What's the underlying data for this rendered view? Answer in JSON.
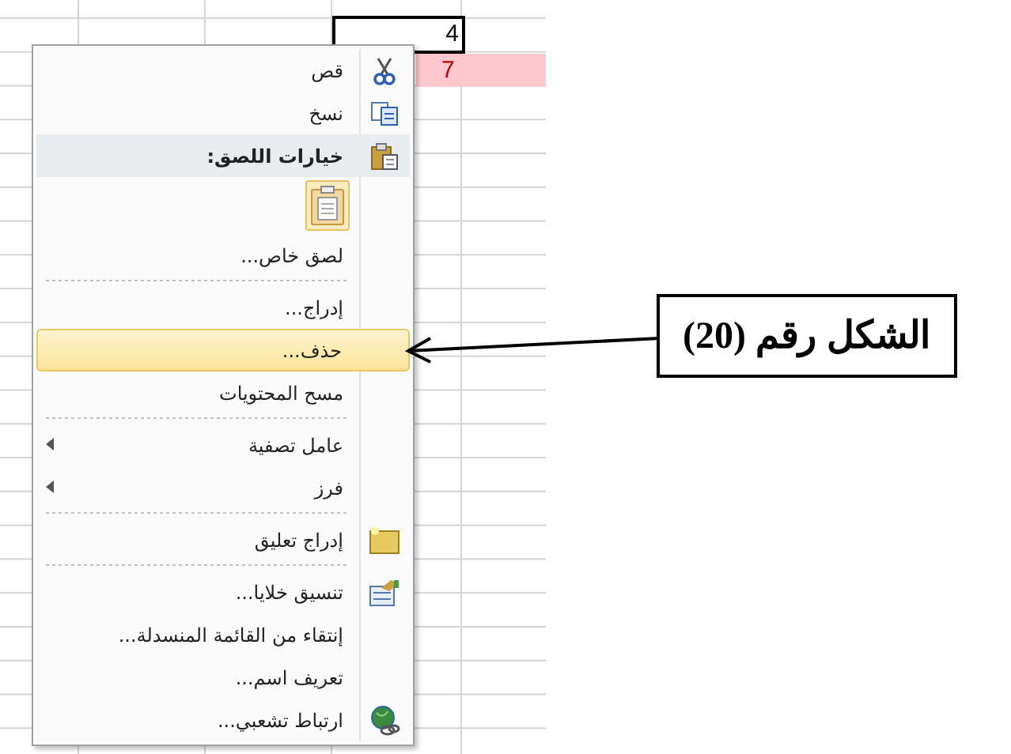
{
  "sheet": {
    "active_cell": "4",
    "highlighted_cell": "7"
  },
  "context_menu": {
    "items": [
      {
        "kind": "item",
        "label": "قص",
        "highlighted": false,
        "submenu": false
      },
      {
        "kind": "item",
        "label": "نسخ",
        "highlighted": false,
        "submenu": false
      },
      {
        "kind": "header",
        "label": "خيارات اللصق:"
      },
      {
        "kind": "paste_option"
      },
      {
        "kind": "item",
        "label": "لصق خاص...",
        "highlighted": false,
        "submenu": false
      },
      {
        "kind": "separator"
      },
      {
        "kind": "item",
        "label": "إدراج...",
        "highlighted": false,
        "submenu": false
      },
      {
        "kind": "item",
        "label": "حذف...",
        "highlighted": true,
        "submenu": false
      },
      {
        "kind": "item",
        "label": "مسح المحتويات",
        "highlighted": false,
        "submenu": false
      },
      {
        "kind": "separator"
      },
      {
        "kind": "item",
        "label": "عامل تصفية",
        "highlighted": false,
        "submenu": true
      },
      {
        "kind": "item",
        "label": "فرز",
        "highlighted": false,
        "submenu": true
      },
      {
        "kind": "separator"
      },
      {
        "kind": "item",
        "label": "إدراج تعليق",
        "highlighted": false,
        "submenu": false
      },
      {
        "kind": "separator"
      },
      {
        "kind": "item",
        "label": "تنسيق خلايا...",
        "highlighted": false,
        "submenu": false
      },
      {
        "kind": "item",
        "label": "إنتقاء من القائمة المنسدلة...",
        "highlighted": false,
        "submenu": false
      },
      {
        "kind": "item",
        "label": "تعريف اسم...",
        "highlighted": false,
        "submenu": false
      },
      {
        "kind": "item",
        "label": "ارتباط تشعبي...",
        "highlighted": false,
        "submenu": false
      }
    ]
  },
  "annotation": {
    "label": "الشكل رقم (20)"
  }
}
